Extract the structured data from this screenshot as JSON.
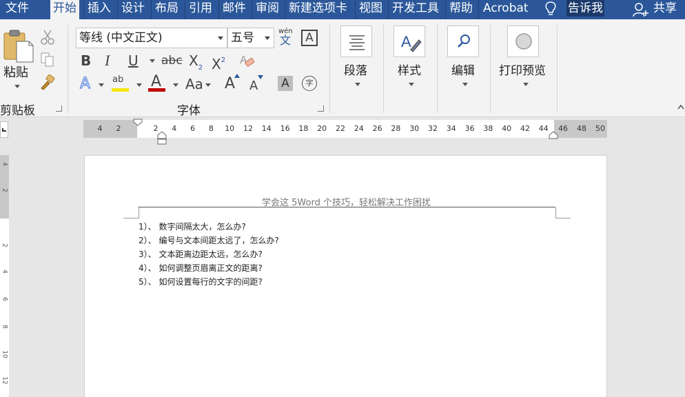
{
  "tabs": {
    "file": "文件",
    "home": "开始",
    "insert": "插入",
    "design": "设计",
    "layout": "布局",
    "references": "引用",
    "mailings": "邮件",
    "review": "审阅",
    "new_tab": "新建选项卡",
    "view": "视图",
    "developer": "开发工具",
    "help": "帮助",
    "acrobat": "Acrobat",
    "tell_me": "告诉我",
    "share": "共享"
  },
  "clipboard": {
    "paste": "粘贴",
    "group_label": "剪贴板"
  },
  "font": {
    "name": "等线 (中文正文)",
    "size": "五号",
    "phonetic_top": "wén",
    "phonetic_bottom": "文",
    "border_char": "A",
    "bold": "B",
    "italic": "I",
    "underline": "U",
    "strike": "abc",
    "subscript": "X",
    "sub_mark": "2",
    "superscript": "X",
    "sup_mark": "2",
    "text_effect": "A",
    "highlight": "ab",
    "font_color": "A",
    "change_case": "Aa",
    "grow": "A",
    "shrink": "A",
    "shading": "A",
    "enclose": "字",
    "group_label": "字体"
  },
  "paragraph": {
    "label": "段落"
  },
  "styles": {
    "label": "样式"
  },
  "editing": {
    "label": "编辑"
  },
  "print_preview": {
    "label": "打印预览"
  },
  "ruler": {
    "left_numbers": [
      "4",
      "2"
    ],
    "right_numbers": [
      "2",
      "4",
      "6",
      "8",
      "10",
      "12",
      "14",
      "16",
      "18",
      "20",
      "22",
      "24",
      "26",
      "28",
      "30",
      "32",
      "34",
      "36",
      "38",
      "40",
      "42",
      "44"
    ],
    "margin_numbers": [
      "46",
      "48",
      "50"
    ],
    "vertical_numbers": [
      "4",
      "2",
      "2",
      "4",
      "6",
      "8",
      "10",
      "12"
    ]
  },
  "document": {
    "header": "学会这 5Word 个技巧，轻松解决工作困扰",
    "lines": [
      "1）、 数字间隔太大，怎么办?",
      "2）、 编号与文本间距太远了，怎么办?",
      "3）、 文本距离边距太远，怎么办?",
      "4）、 如何调整页眉离正文的距离?",
      "5）、 如何设置每行的文字的间距?"
    ]
  },
  "colors": {
    "brand": "#2b579a",
    "highlight_bar": "#f5e50b",
    "font_color_bar": "#c00000",
    "text_effect": "#3a6fd8"
  }
}
